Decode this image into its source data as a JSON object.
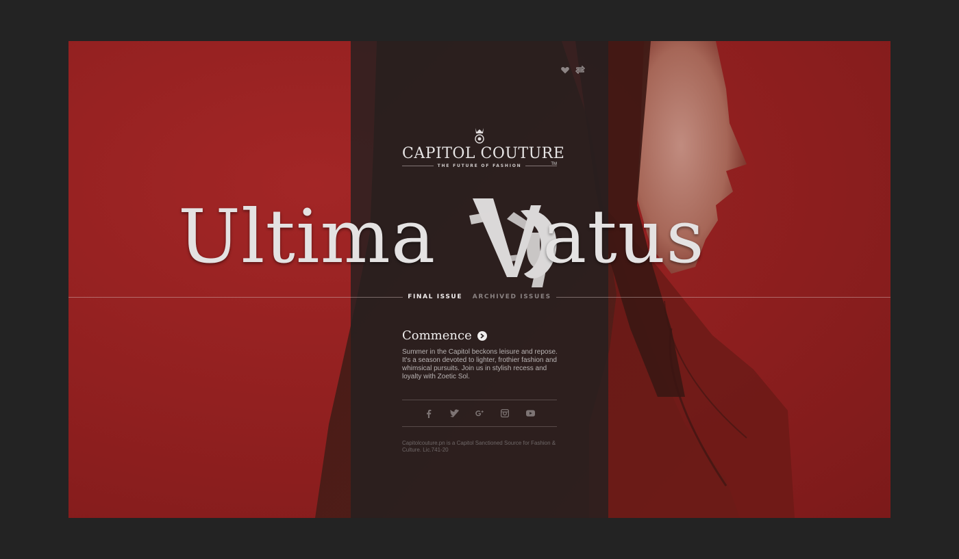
{
  "brand": {
    "name": "CAPITOL COUTURE",
    "trademark": "TM",
    "tagline": "THE FUTURE OF FASHION",
    "crest_icon": "crown-crest-icon"
  },
  "headline": {
    "word_left": "Ultima",
    "word_right": "atus",
    "glyph_icon": "fractured-v-o-monogram"
  },
  "top_actions": [
    {
      "icon": "heart-icon"
    },
    {
      "icon": "repeat-icon"
    }
  ],
  "nav": {
    "final_issue": "FINAL ISSUE",
    "archived_issues": "ARCHIVED ISSUES"
  },
  "intro": {
    "title": "Commence",
    "body": "Summer in the Capitol beckons leisure and repose. It's a season devoted to lighter, frothier fashion and whimsical pursuits.  Join us in stylish recess and loyalty with Zoetic Sol."
  },
  "social": [
    {
      "icon": "facebook-icon"
    },
    {
      "icon": "twitter-icon"
    },
    {
      "icon": "google-plus-icon"
    },
    {
      "icon": "instagram-icon"
    },
    {
      "icon": "youtube-icon"
    }
  ],
  "footer": {
    "legal": "Capitolcouture.pn is a Capitol Sanctioned Source for Fashion & Culture. Lic.741-20"
  },
  "colors": {
    "background": "#232323",
    "accent_red": "#9a2323",
    "panel": "#262020",
    "text_light": "#e4e2e2"
  }
}
